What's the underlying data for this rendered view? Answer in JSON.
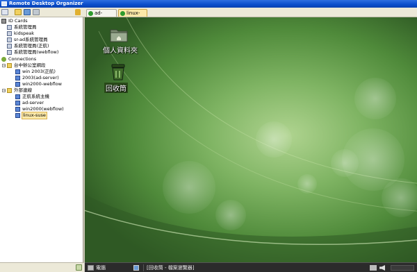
{
  "window": {
    "title": "Remote Desktop Organizer"
  },
  "tabs": [
    {
      "label": "ad-server",
      "icon": "connection-icon"
    },
    {
      "label": "linux-suse",
      "icon": "connection-icon",
      "active": true
    }
  ],
  "tree": {
    "id_cards": {
      "label": "ID Cards",
      "items": [
        "系統管理員",
        "kidspeak",
        "sr-ad系統管理員",
        "系統管理員(正航)",
        "系統管理員(webflow)"
      ]
    },
    "connections": {
      "label": "Connections",
      "groups": [
        {
          "label": "台中辦公室網段",
          "items": [
            "win 2003(正航)",
            "2003(ad-server)",
            "win2000-webflow"
          ]
        },
        {
          "label": "外部連線",
          "items": [
            "正航系統主機",
            "ad-server",
            "win2000(webflow)",
            "linux-suse"
          ]
        }
      ]
    },
    "selected": "linux-suse"
  },
  "desktop": {
    "icons": [
      {
        "label": "個人資料夾",
        "icon": "home-folder-icon"
      },
      {
        "label": "回收筒",
        "icon": "trash-icon"
      }
    ]
  },
  "taskbar": {
    "computer_label": "電腦",
    "window_label": "[回收筒 - 檔案瀏覽器]"
  },
  "colors": {
    "titlebar": "#0a4ecb",
    "selected_tab": "#fde9a8",
    "desktop_green": "#7fb463"
  }
}
